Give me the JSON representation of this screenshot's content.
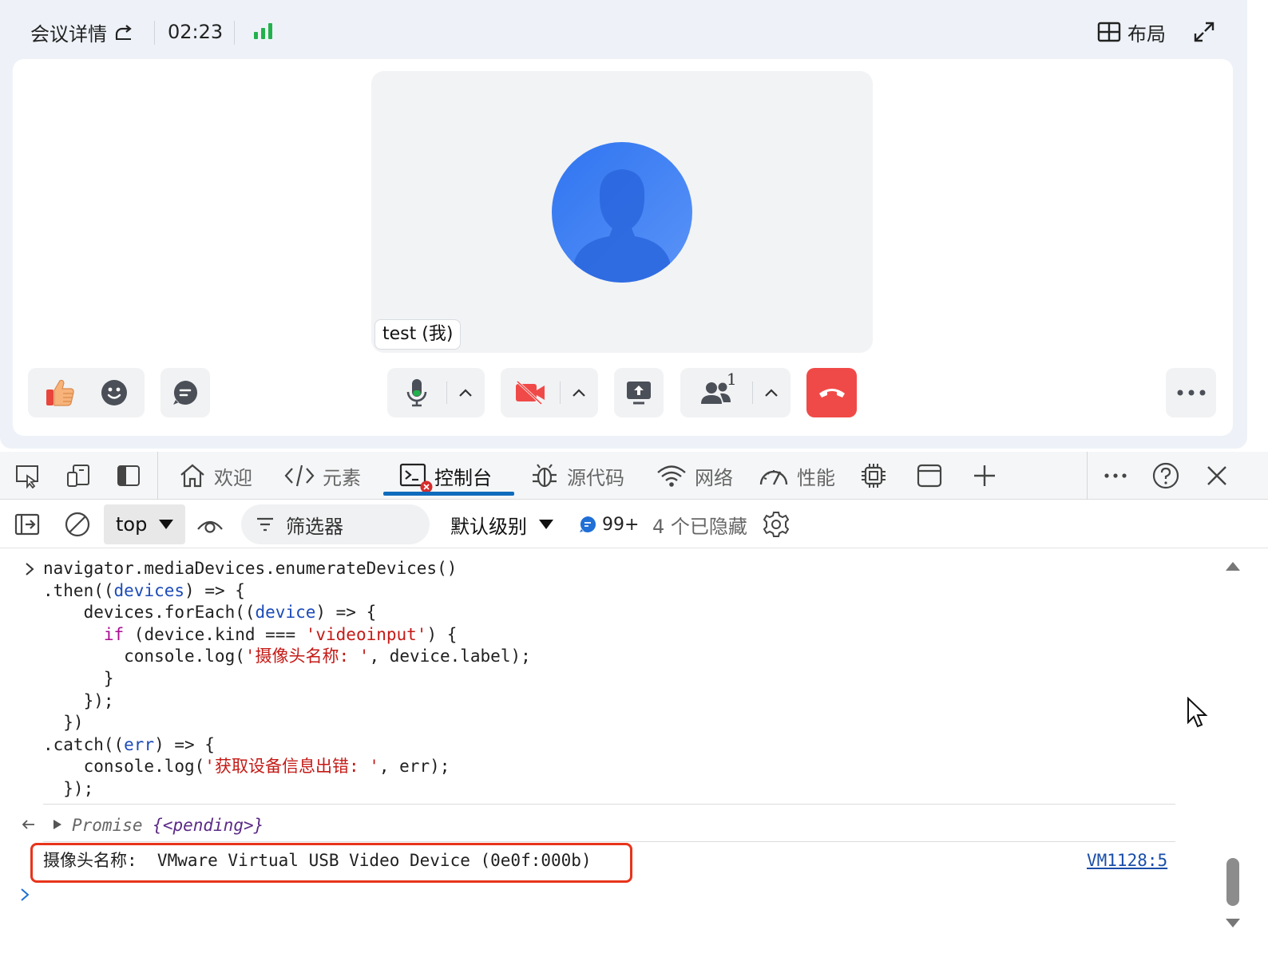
{
  "meeting": {
    "details_label": "会议详情",
    "timer": "02:23",
    "layout_label": "布局",
    "participant_name": "test (我)",
    "participant_count": "1",
    "colors": {
      "accent": "#2f74f0",
      "hangup": "#f04a48",
      "signal": "#22b14c"
    }
  },
  "devtools": {
    "tabs": [
      {
        "label": "欢迎",
        "icon": "home-icon"
      },
      {
        "label": "元素",
        "icon": "code-icon"
      },
      {
        "label": "控制台",
        "icon": "console-icon",
        "active": true
      },
      {
        "label": "源代码",
        "icon": "bug-icon"
      },
      {
        "label": "网络",
        "icon": "wifi-icon"
      },
      {
        "label": "性能",
        "icon": "gauge-icon"
      }
    ],
    "context": "top",
    "filter_placeholder": "筛选器",
    "level": "默认级别",
    "message_count": "99+",
    "hidden": "4 个已隐藏"
  },
  "console": {
    "input_lines": [
      "navigator.mediaDevices.enumerateDevices()",
      ".then((devices) => {",
      "devices.forEach((device) => {",
      "if (device.kind === 'videoinput') {",
      "console.log('摄像头名称: ', device.label);",
      "}",
      "});",
      "})",
      ".catch((err) => {",
      "console.log('获取设备信息出错: ', err);",
      "});"
    ],
    "result_prefix": "Promise",
    "result_state": "{<pending>}",
    "log_text": "摄像头名称:  VMware Virtual USB Video Device (0e0f:000b)",
    "log_source": "VM1128:5"
  }
}
